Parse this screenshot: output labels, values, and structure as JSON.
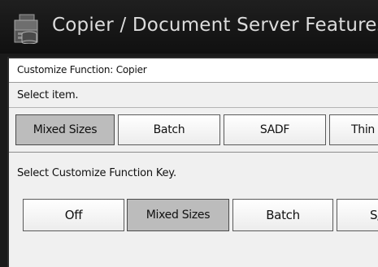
{
  "header": {
    "title": "Copier / Document Server Features",
    "icon": "copier-document-server-icon"
  },
  "breadcrumb": {
    "text": "Customize Function: Copier"
  },
  "select_item": {
    "label": "Select item.",
    "buttons": [
      {
        "label": "Mixed Sizes",
        "selected": true
      },
      {
        "label": "Batch",
        "selected": false
      },
      {
        "label": "SADF",
        "selected": false
      },
      {
        "label": "Thin P",
        "selected": false
      }
    ]
  },
  "function_key": {
    "label": "Select Customize Function Key.",
    "buttons": [
      {
        "label": "Off",
        "selected": false
      },
      {
        "label": "Mixed Sizes",
        "selected": true
      },
      {
        "label": "Batch",
        "selected": false
      },
      {
        "label": "S/",
        "selected": false
      }
    ]
  },
  "colors": {
    "title_bar": "#141414",
    "title_text": "#dcdcdc",
    "panel": "#f0f0f0",
    "selected_button": "#bcbcbc"
  }
}
